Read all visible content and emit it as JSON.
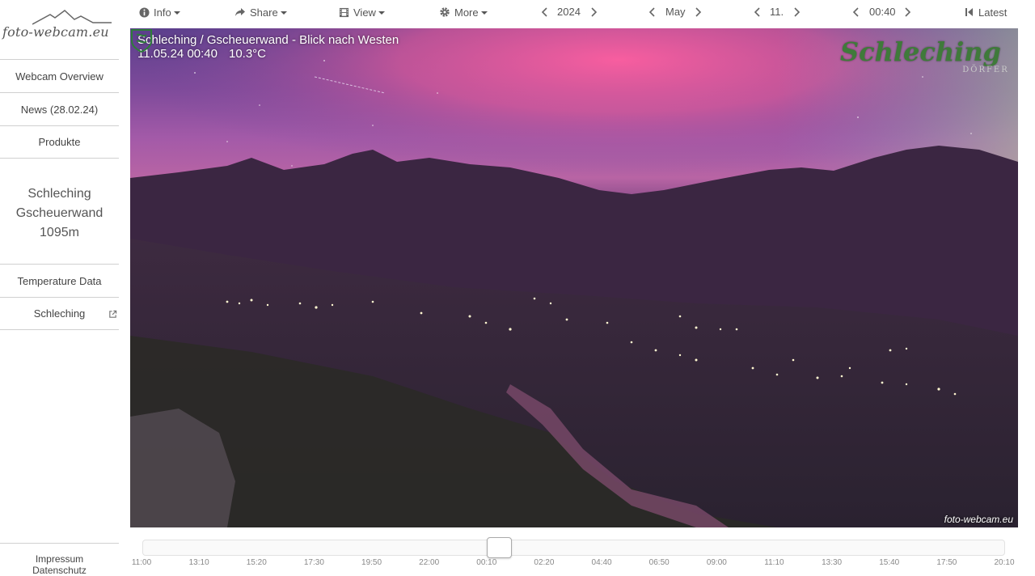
{
  "sidebar": {
    "logo_text": "foto-webcam.eu",
    "nav": {
      "overview": "Webcam Overview",
      "news": "News (28.02.24)",
      "produkte": "Produkte",
      "temperature": "Temperature Data",
      "schleching": "Schleching"
    },
    "station": {
      "line1": "Schleching",
      "line2": "Gscheuerwand",
      "line3": "1095m"
    },
    "footer": {
      "impressum": "Impressum",
      "datenschutz": "Datenschutz"
    }
  },
  "toolbar": {
    "info": "Info",
    "share": "Share",
    "view": "View",
    "more": "More",
    "year": "2024",
    "month": "May",
    "day": "11.",
    "time": "00:40",
    "latest": "Latest"
  },
  "webcam": {
    "title": "Schleching / Gscheuerwand - Blick nach Westen",
    "datetime": "11.05.24 00:40",
    "temperature": "10.3°C",
    "brand": "Schleching",
    "brand_sub": "DÖRFER",
    "watermark": "foto-webcam.eu",
    "sky_colors": [
      "#5a3f8c",
      "#b864a4",
      "#e0588f",
      "#2a1c30"
    ]
  },
  "timeline": {
    "ticks": [
      "11:00",
      "13:10",
      "15:20",
      "17:30",
      "19:50",
      "22:00",
      "00:10",
      "02:20",
      "04:40",
      "06:50",
      "09:00",
      "11:10",
      "13:30",
      "15:40",
      "17:50",
      "20:10"
    ],
    "position_fraction": 0.411
  }
}
